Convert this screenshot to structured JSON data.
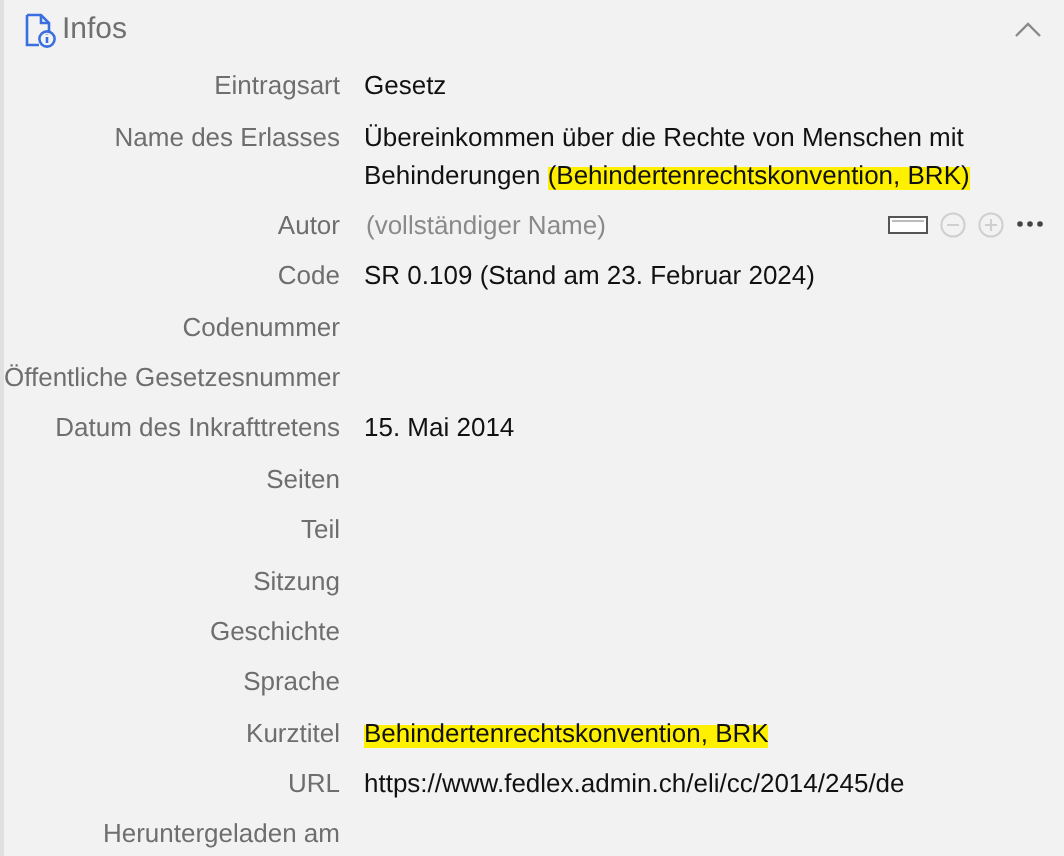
{
  "section": {
    "title": "Infos",
    "expanded": true
  },
  "fields": [
    {
      "kind": "text",
      "label": "Eintragsart",
      "value_parts": [
        {
          "text": "Gesetz",
          "highlighted": false
        }
      ]
    },
    {
      "kind": "text",
      "label": "Name des Erlasses",
      "value_parts": [
        {
          "text": "Übereinkommen über die Rechte von Menschen mit Behinderungen ",
          "highlighted": false
        },
        {
          "text": "(Behindertenrechtskonvention, BRK)",
          "highlighted": true
        }
      ]
    },
    {
      "kind": "person",
      "label": "Autor",
      "placeholder": "(vollständiger Name)"
    },
    {
      "kind": "text",
      "label": "Code",
      "value_parts": [
        {
          "text": "SR 0.109 (Stand am 23. Februar 2024)",
          "highlighted": false
        }
      ]
    },
    {
      "kind": "text",
      "label": "Codenummer"
    },
    {
      "kind": "text",
      "label": "Öffentliche Gesetzesnummer"
    },
    {
      "kind": "text",
      "label": "Datum des Inkrafttretens",
      "value_parts": [
        {
          "text": "15. Mai 2014",
          "highlighted": false
        }
      ]
    },
    {
      "kind": "text",
      "label": "Seiten"
    },
    {
      "kind": "text",
      "label": "Teil"
    },
    {
      "kind": "text",
      "label": "Sitzung"
    },
    {
      "kind": "text",
      "label": "Geschichte"
    },
    {
      "kind": "text",
      "label": "Sprache"
    },
    {
      "kind": "text",
      "label": "Kurztitel",
      "value_parts": [
        {
          "text": "Behindertenrechtskonvention, BRK",
          "highlighted": true
        }
      ]
    },
    {
      "kind": "text",
      "label": "URL",
      "value_parts": [
        {
          "text": "https://www.fedlex.admin.ch/eli/cc/2014/245/de",
          "highlighted": false
        }
      ]
    },
    {
      "kind": "text",
      "label": "Heruntergeladen am"
    }
  ]
}
